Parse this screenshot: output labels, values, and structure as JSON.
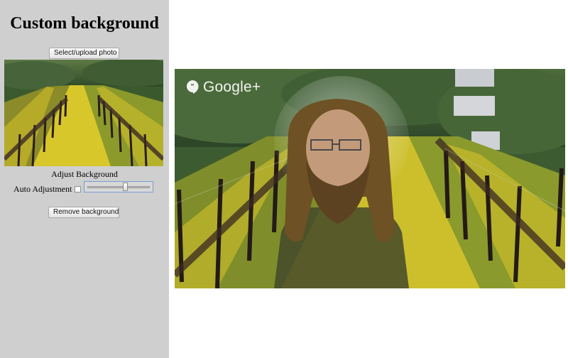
{
  "sidebar": {
    "title": "Custom background",
    "upload_button_label": "Select/upload photo",
    "adjust_label": "Adjust Background",
    "auto_adjustment_label": "Auto Adjustment",
    "auto_adjustment_checked": false,
    "slider_level": 0.62,
    "remove_button_label": "Remove background",
    "thumbnail_icon": "vineyard-photo"
  },
  "video": {
    "brand_text": "Google+",
    "brand_icon": "hangouts-quote-icon"
  },
  "colors": {
    "sidebar_bg": "#cfcfcf",
    "page_bg": "#ffffff"
  }
}
